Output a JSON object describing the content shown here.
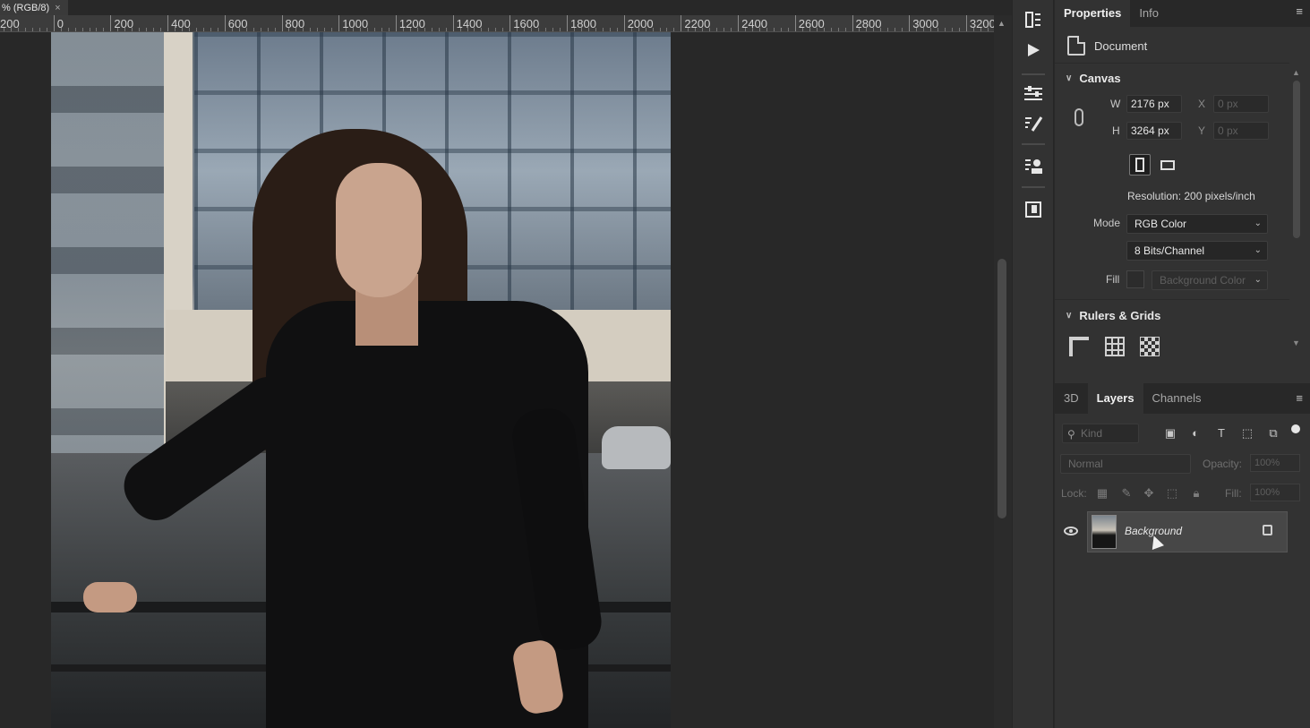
{
  "document": {
    "tab_title": "% (RGB/8)",
    "tab_close": "×",
    "ruler_labels": [
      "200",
      "0",
      "200",
      "400",
      "600",
      "800",
      "1000",
      "1200",
      "1400",
      "1600",
      "1800",
      "2000",
      "2200",
      "2400",
      "2600",
      "2800",
      "3000",
      "3200"
    ]
  },
  "properties_panel": {
    "tabs": [
      "Properties",
      "Info"
    ],
    "menu_icon": "≡",
    "doc_label": "Document",
    "canvas_section": "Canvas",
    "width_label": "W",
    "width_value": "2176 px",
    "height_label": "H",
    "height_value": "3264 px",
    "x_label": "X",
    "x_value": "0 px",
    "y_label": "Y",
    "y_value": "0 px",
    "resolution": "Resolution: 200 pixels/inch",
    "mode_label": "Mode",
    "mode_value": "RGB Color",
    "bits_value": "8 Bits/Channel",
    "fill_label": "Fill",
    "fill_value": "Background Color",
    "rulers_section": "Rulers & Grids"
  },
  "layers_panel": {
    "tabs": [
      "3D",
      "Layers",
      "Channels"
    ],
    "menu_icon": "≡",
    "search_placeholder": "Kind",
    "blend_mode": "Normal",
    "opacity_label": "Opacity:",
    "opacity_value": "100%",
    "lock_label": "Lock:",
    "fill_label": "Fill:",
    "fill_value": "100%",
    "layers": [
      {
        "name": "Background",
        "visible": true,
        "locked": true
      }
    ]
  },
  "colors": {
    "app_bg": "#282828",
    "panel_bg": "#323232",
    "selected_layer": "#474747"
  }
}
